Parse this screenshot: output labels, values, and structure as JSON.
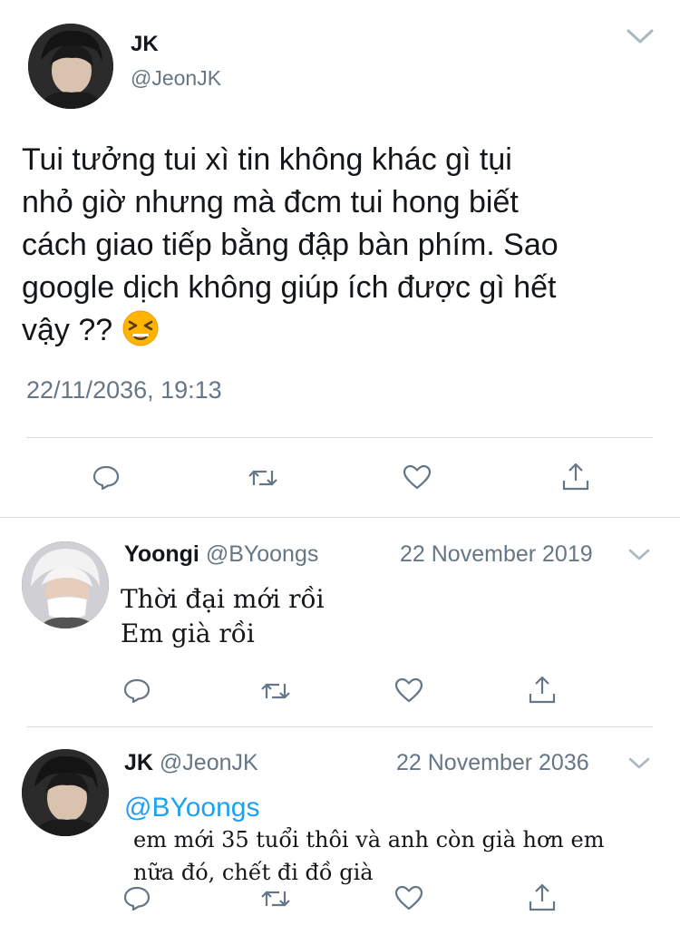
{
  "colors": {
    "text": "#14171a",
    "muted": "#657786",
    "link": "#1da1f2",
    "divider": "#d5dadf"
  },
  "main_tweet": {
    "author_name": "JK",
    "author_handle": "@JeonJK",
    "text_lines": [
      "Tui tưởng tui xì tin không khác gì tụi",
      "nhỏ giờ nhưng mà đcm tui hong biết",
      "cách giao tiếp bằng đập bàn phím. Sao",
      "google dịch không giúp ích được gì hết",
      "vậy ??"
    ],
    "emoji": "😫",
    "timestamp": "22/11/2036, 19:13"
  },
  "replies": [
    {
      "author_name": "Yoongi",
      "author_handle": "@BYoongs",
      "date": "22 November 2019",
      "text_lines": [
        "Thời đại mới rồi",
        "Em già rồi"
      ]
    },
    {
      "author_name": "JK",
      "author_handle": "@JeonJK",
      "date": "22 November 2036",
      "mention": "@BYoongs",
      "text_lines": [
        "em mới 35 tuổi thôi và anh còn già hơn em",
        "nữa đó, chết đi đồ già"
      ]
    }
  ],
  "icons": [
    "chevron-down-icon",
    "reply-icon",
    "retweet-icon",
    "like-icon",
    "share-icon"
  ]
}
